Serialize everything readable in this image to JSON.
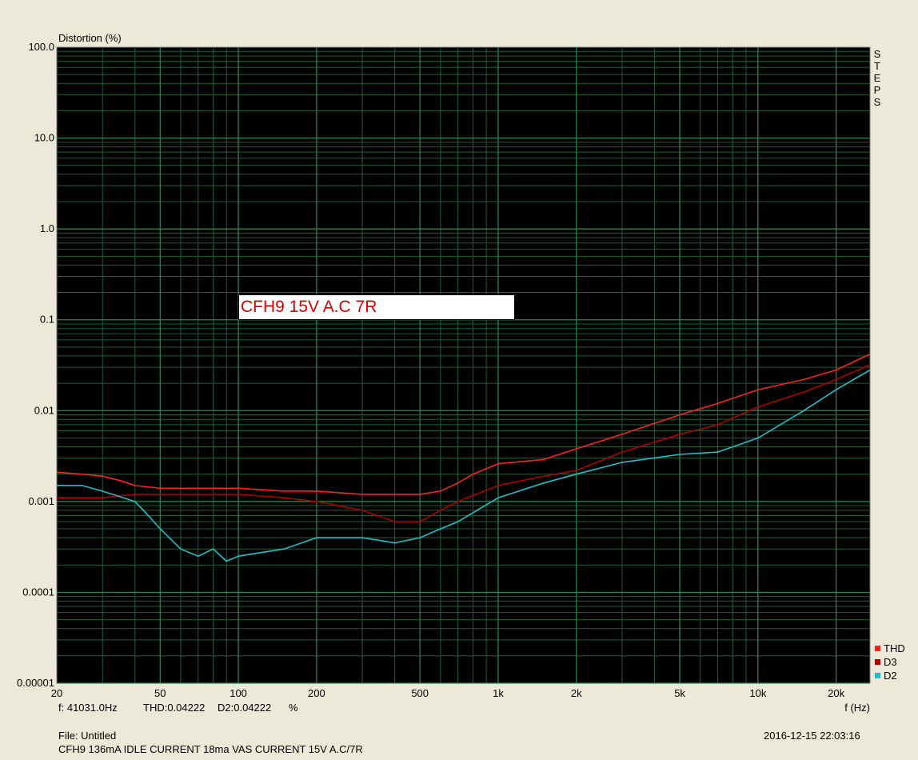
{
  "chart_data": {
    "type": "line",
    "ylabel": "Distortion (%)",
    "xlabel": "f (Hz)",
    "x_scale": "log",
    "y_scale": "log",
    "xlim": [
      20,
      27000
    ],
    "ylim": [
      1e-05,
      100
    ],
    "grid": true,
    "x_ticks": [
      20,
      50,
      100,
      200,
      500,
      1000,
      2000,
      5000,
      10000,
      20000
    ],
    "x_tick_labels": [
      "20",
      "50",
      "100",
      "200",
      "500",
      "1k",
      "2k",
      "5k",
      "10k",
      "20k"
    ],
    "y_ticks": [
      1e-05,
      0.0001,
      0.001,
      0.01,
      0.1,
      1,
      10,
      100
    ],
    "y_tick_labels": [
      "0.00001",
      "0.0001",
      "0.001",
      "0.01",
      "0.1",
      "1.0",
      "10.0",
      "100.0"
    ],
    "legend_position": "bottom-right",
    "series": [
      {
        "name": "THD",
        "color": "#ff2020",
        "points": [
          [
            20,
            0.0021
          ],
          [
            25,
            0.002
          ],
          [
            30,
            0.0019
          ],
          [
            35,
            0.0017
          ],
          [
            40,
            0.0015
          ],
          [
            50,
            0.0014
          ],
          [
            60,
            0.0014
          ],
          [
            80,
            0.0014
          ],
          [
            100,
            0.0014
          ],
          [
            150,
            0.0013
          ],
          [
            200,
            0.0013
          ],
          [
            300,
            0.0012
          ],
          [
            400,
            0.0012
          ],
          [
            500,
            0.0012
          ],
          [
            600,
            0.0013
          ],
          [
            700,
            0.0016
          ],
          [
            800,
            0.002
          ],
          [
            1000,
            0.0026
          ],
          [
            1500,
            0.0029
          ],
          [
            2000,
            0.0038
          ],
          [
            3000,
            0.0055
          ],
          [
            5000,
            0.009
          ],
          [
            7000,
            0.012
          ],
          [
            10000,
            0.017
          ],
          [
            15000,
            0.022
          ],
          [
            20000,
            0.028
          ],
          [
            27000,
            0.042
          ]
        ]
      },
      {
        "name": "D3",
        "color": "#b00000",
        "points": [
          [
            20,
            0.0011
          ],
          [
            30,
            0.0011
          ],
          [
            40,
            0.0012
          ],
          [
            50,
            0.0012
          ],
          [
            70,
            0.0012
          ],
          [
            100,
            0.0012
          ],
          [
            150,
            0.0011
          ],
          [
            200,
            0.001
          ],
          [
            300,
            0.0008
          ],
          [
            400,
            0.0006
          ],
          [
            500,
            0.0006
          ],
          [
            600,
            0.0008
          ],
          [
            700,
            0.001
          ],
          [
            1000,
            0.0015
          ],
          [
            1500,
            0.0019
          ],
          [
            2000,
            0.0022
          ],
          [
            3000,
            0.0035
          ],
          [
            5000,
            0.0055
          ],
          [
            7000,
            0.007
          ],
          [
            10000,
            0.011
          ],
          [
            15000,
            0.016
          ],
          [
            20000,
            0.022
          ],
          [
            27000,
            0.032
          ]
        ]
      },
      {
        "name": "D2",
        "color": "#20c0c8",
        "points": [
          [
            20,
            0.0015
          ],
          [
            25,
            0.0015
          ],
          [
            30,
            0.0013
          ],
          [
            40,
            0.001
          ],
          [
            45,
            0.0007
          ],
          [
            50,
            0.0005
          ],
          [
            60,
            0.0003
          ],
          [
            70,
            0.00025
          ],
          [
            80,
            0.0003
          ],
          [
            90,
            0.00022
          ],
          [
            100,
            0.00025
          ],
          [
            150,
            0.0003
          ],
          [
            200,
            0.0004
          ],
          [
            300,
            0.0004
          ],
          [
            400,
            0.00035
          ],
          [
            500,
            0.0004
          ],
          [
            600,
            0.0005
          ],
          [
            700,
            0.0006
          ],
          [
            1000,
            0.0011
          ],
          [
            1500,
            0.0016
          ],
          [
            2000,
            0.002
          ],
          [
            3000,
            0.0027
          ],
          [
            5000,
            0.0033
          ],
          [
            7000,
            0.0035
          ],
          [
            10000,
            0.005
          ],
          [
            15000,
            0.01
          ],
          [
            20000,
            0.017
          ],
          [
            27000,
            0.028
          ]
        ]
      }
    ],
    "annotation": "CFH9 15V A.C 7R"
  },
  "steps_label": [
    "S",
    "T",
    "E",
    "P",
    "S"
  ],
  "readout": {
    "freq": "f: 41031.0Hz",
    "thd": "THD:0.04222",
    "d2": "D2:0.04222",
    "unit": "%"
  },
  "footer": {
    "file": "File: Untitled",
    "description": "CFH9 136mA IDLE CURRENT 18ma VAS CURRENT 15V A.C/7R",
    "timestamp": "2016-12-15 22:03:16"
  }
}
